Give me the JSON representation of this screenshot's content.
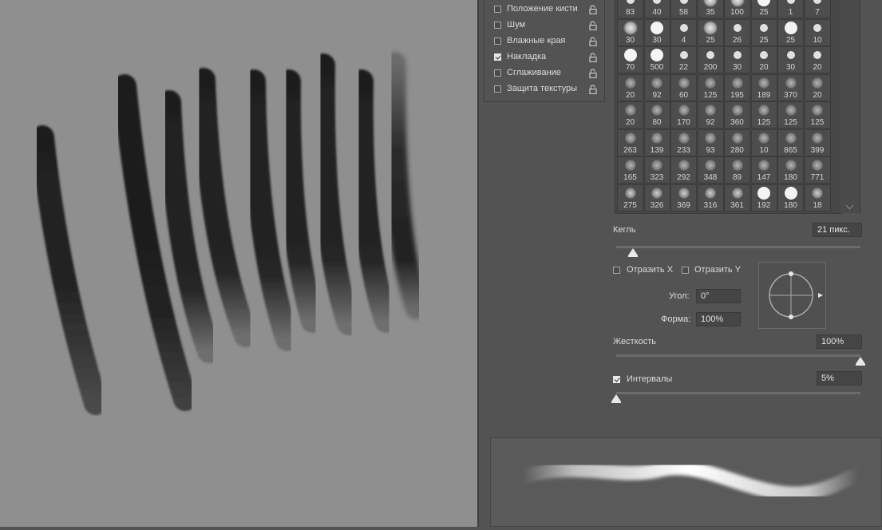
{
  "brush_options": {
    "items": [
      {
        "label": "Положение кисти",
        "checked": false
      },
      {
        "label": "Шум",
        "checked": false
      },
      {
        "label": "Влажные края",
        "checked": false
      },
      {
        "label": "Накладка",
        "checked": true
      },
      {
        "label": "Сглаживание",
        "checked": false
      },
      {
        "label": "Защита текстуры",
        "checked": false
      }
    ]
  },
  "brush_presets": [
    "83",
    "40",
    "58",
    "35",
    "100",
    "25",
    "1",
    "7",
    "30",
    "30",
    "4",
    "25",
    "26",
    "25",
    "25",
    "10",
    "70",
    "500",
    "22",
    "200",
    "30",
    "20",
    "30",
    "20",
    "20",
    "92",
    "60",
    "125",
    "195",
    "189",
    "370",
    "20",
    "20",
    "80",
    "170",
    "92",
    "360",
    "125",
    "125",
    "125",
    "263",
    "139",
    "233",
    "93",
    "280",
    "10",
    "865",
    "399",
    "165",
    "323",
    "292",
    "348",
    "89",
    "147",
    "180",
    "771",
    "275",
    "326",
    "369",
    "316",
    "361",
    "192",
    "180",
    "18"
  ],
  "brush_settings": {
    "size_label": "Кегль",
    "size_value": "21 пикс.",
    "size_fraction": 0.07,
    "flip_x_label": "Отразить X",
    "flip_y_label": "Отразить Y",
    "flip_x": false,
    "flip_y": false,
    "angle_label": "Угол:",
    "angle_value": "0°",
    "roundness_label": "Форма:",
    "roundness_value": "100%",
    "hardness_label": "Жесткость",
    "hardness_value": "100%",
    "hardness_fraction": 1.0,
    "spacing_label": "Интервалы",
    "spacing_checked": true,
    "spacing_value": "5%",
    "spacing_fraction": 0.0
  },
  "colors": {
    "panel": "#535353",
    "canvas": "#8f8f8f",
    "stroke": "#1e1e1e"
  }
}
